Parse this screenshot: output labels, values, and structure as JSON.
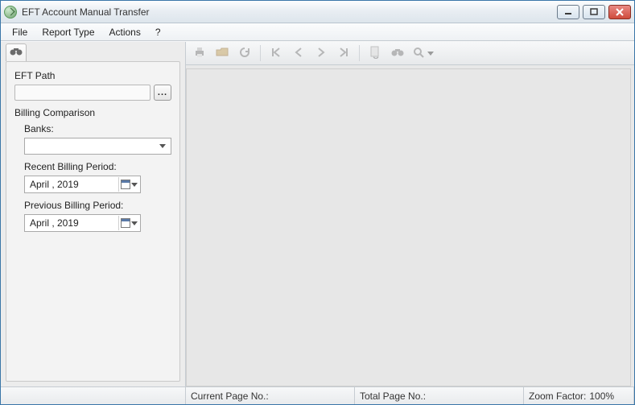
{
  "window": {
    "title": "EFT Account Manual Transfer"
  },
  "menu": {
    "file": "File",
    "report_type": "Report Type",
    "actions": "Actions",
    "help": "?"
  },
  "sidebar": {
    "eft_path_label": "EFT Path",
    "eft_path_value": "",
    "browse_label": "...",
    "billing_comparison_label": "Billing Comparison",
    "banks_label": "Banks:",
    "banks_value": "",
    "recent_label": "Recent Billing Period:",
    "recent_value": "April    , 2019",
    "previous_label": "Previous Billing Period:",
    "previous_value": "April    , 2019"
  },
  "status": {
    "current_page_label": "Current Page No.:",
    "current_page_value": "",
    "total_page_label": "Total Page No.:",
    "total_page_value": "",
    "zoom_label": "Zoom Factor:",
    "zoom_value": "100%"
  },
  "icons": {
    "binoculars": "binoculars-icon"
  }
}
